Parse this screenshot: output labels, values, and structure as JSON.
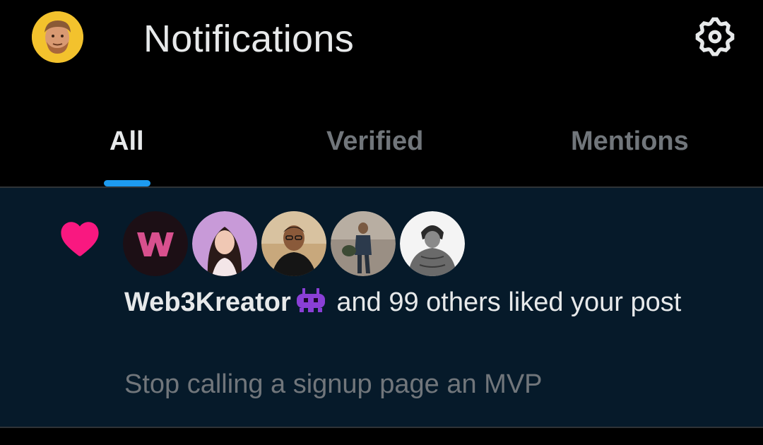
{
  "header": {
    "title": "Notifications",
    "avatar_icon": "user-avatar-icon",
    "settings_icon": "gear-icon"
  },
  "tabs": [
    {
      "label": "All",
      "active": true
    },
    {
      "label": "Verified",
      "active": false
    },
    {
      "label": "Mentions",
      "active": false
    }
  ],
  "notification": {
    "type_icon": "heart-icon",
    "actor_name": "Web3Kreator",
    "actor_emoji_icon": "purple-alien-monster-icon",
    "action_text": " and 99 others liked your post",
    "post_preview": "Stop calling a signup page an MVP",
    "avatars": [
      "web3kreator-avatar",
      "woman-avatar",
      "man-glasses-avatar",
      "man-walking-avatar",
      "anime-fighter-avatar"
    ]
  },
  "colors": {
    "background": "#000000",
    "notification_bg": "#061a2a",
    "accent": "#1d9bf0",
    "heart": "#f91880",
    "primary_text": "#e7e9ea",
    "secondary_text": "#71767b"
  }
}
